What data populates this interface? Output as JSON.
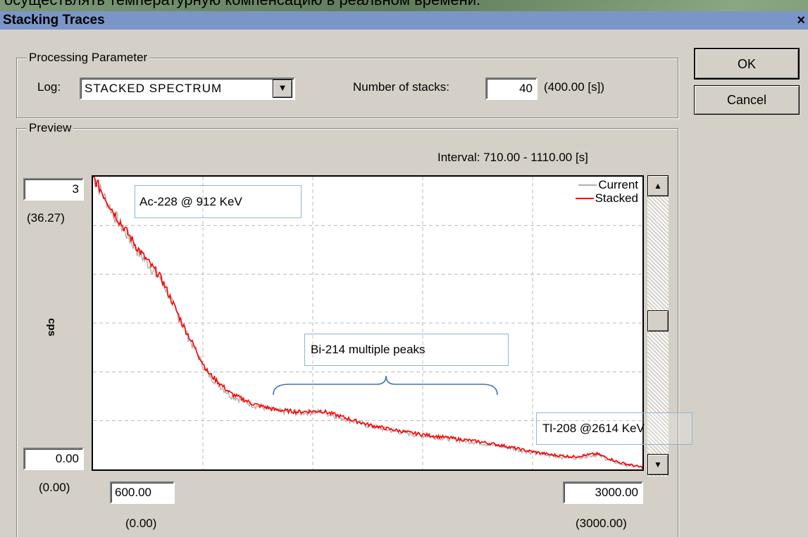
{
  "background_text": "осуществлять температурную компенсацию в реальном времени.",
  "window": {
    "title": "Stacking Traces",
    "close_glyph": "×"
  },
  "buttons": {
    "ok": "OK",
    "cancel": "Cancel"
  },
  "processing": {
    "group_label": "Processing Parameter",
    "log_label": "Log:",
    "log_value": "STACKED SPECTRUM",
    "stacks_label": "Number of stacks:",
    "stacks_value": "40",
    "stacks_duration": "(400.00 [s])"
  },
  "preview": {
    "group_label": "Preview",
    "interval": "Interval: 710.00 - 1110.00 [s]",
    "y_max_field": "3",
    "y_max_paren": "(36.27)",
    "y_axis_label": "cps",
    "y_min_field": "0.00",
    "y_min_paren": "(0.00)",
    "x_min_field": "600.00",
    "x_min_paren": "(0.00)",
    "x_max_field": "3000.00",
    "x_max_paren": "(3000.00)"
  },
  "annotations": {
    "ac228": "Ac-228 @ 912 KeV",
    "bi214": "Bi-214 multiple peaks",
    "tl208": "Tl-208 @2614 KeV"
  },
  "colors": {
    "current": "#b0b0b0",
    "stacked": "#ff0000",
    "titlebar": "#7a96c8",
    "window": "#d4d0c8"
  },
  "chart_data": {
    "type": "line",
    "xlim": [
      600,
      3000
    ],
    "ylim": [
      0,
      3
    ],
    "ylabel": "cps",
    "grid": true,
    "legend": "top-right",
    "series": [
      {
        "name": "Current",
        "color": "#b0b0b0",
        "x": [
          600,
          700,
          800,
          900,
          950,
          1000,
          1100,
          1200,
          1300,
          1400,
          1500,
          1600,
          1700,
          1800,
          1900,
          2000,
          2100,
          2200,
          2300,
          2400,
          2500,
          2600,
          2700,
          2800,
          2900,
          3000
        ],
        "y": [
          3.0,
          2.58,
          2.22,
          1.95,
          1.68,
          1.43,
          0.98,
          0.76,
          0.66,
          0.6,
          0.58,
          0.59,
          0.52,
          0.45,
          0.4,
          0.36,
          0.33,
          0.3,
          0.27,
          0.23,
          0.18,
          0.14,
          0.12,
          0.15,
          0.06,
          0.02
        ]
      },
      {
        "name": "Stacked",
        "color": "#ff0000",
        "x": [
          600,
          700,
          800,
          900,
          950,
          1000,
          1100,
          1200,
          1300,
          1400,
          1500,
          1600,
          1700,
          1800,
          1900,
          2000,
          2100,
          2200,
          2300,
          2400,
          2500,
          2600,
          2700,
          2800,
          2900,
          3000
        ],
        "y": [
          3.0,
          2.6,
          2.25,
          1.95,
          1.7,
          1.45,
          1.0,
          0.78,
          0.67,
          0.61,
          0.59,
          0.6,
          0.53,
          0.46,
          0.41,
          0.37,
          0.34,
          0.31,
          0.28,
          0.24,
          0.19,
          0.15,
          0.13,
          0.16,
          0.07,
          0.02
        ]
      }
    ]
  }
}
